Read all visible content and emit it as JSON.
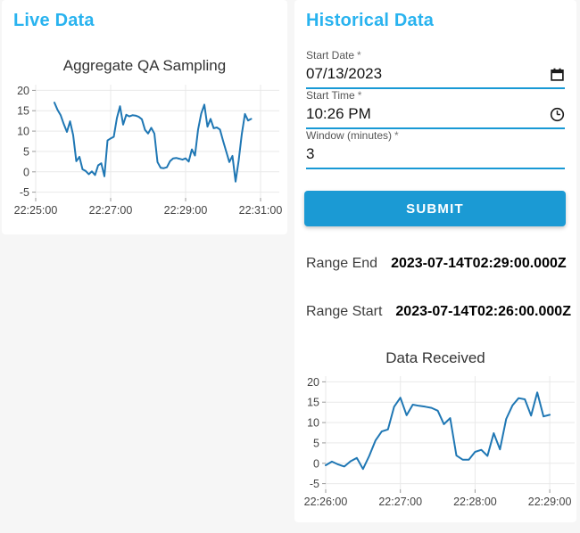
{
  "colors": {
    "heading_blue": "#29b3ef",
    "accent_blue": "#1899d5",
    "submit_blue": "#1b9ad4",
    "chart_line": "#1f77b4",
    "grid_gray": "#e9e9e9"
  },
  "live_panel": {
    "heading": "Live Data"
  },
  "historical_panel": {
    "heading": "Historical Data",
    "form": {
      "fields": [
        {
          "label": "Start Date",
          "required_marker": "*",
          "value": "07/13/2023",
          "icon": "calendar-icon"
        },
        {
          "label": "Start Time",
          "required_marker": "*",
          "value": "10:26 PM",
          "icon": "clock-icon"
        },
        {
          "label": "Window (minutes)",
          "required_marker": "*",
          "value": "3",
          "icon": ""
        }
      ],
      "submit_label": "SUBMIT"
    },
    "results": [
      {
        "label": "Range End",
        "value": "2023-07-14T02:29:00.000Z"
      },
      {
        "label": "Range Start",
        "value": "2023-07-14T02:26:00.000Z"
      }
    ]
  },
  "chart_data": [
    {
      "type": "line",
      "title": "Aggregate QA Sampling",
      "xlabel": "",
      "ylabel": "",
      "grid": true,
      "legend": false,
      "x_tick_labels": [
        "22:25:00",
        "22:27:00",
        "22:29:00",
        "22:31:00"
      ],
      "x_tick_seconds": [
        0,
        120,
        240,
        360
      ],
      "x_range_seconds": [
        0,
        390
      ],
      "x_axis_start_time": "22:25:00",
      "y_ticks": [
        -5,
        0,
        5,
        10,
        15,
        20
      ],
      "y_range": [
        -6.4,
        21.4
      ],
      "series_start_time": "22:25:30",
      "series_start_seconds": 30,
      "series_step_seconds": 5,
      "values": [
        17.0,
        15.2,
        13.9,
        11.7,
        9.8,
        12.4,
        9.0,
        2.6,
        3.7,
        0.6,
        0.2,
        -0.6,
        0.1,
        -0.8,
        1.6,
        2.1,
        -1.1,
        7.7,
        8.2,
        8.6,
        13.2,
        16.1,
        11.6,
        14.0,
        13.6,
        13.9,
        13.8,
        13.5,
        12.9,
        10.3,
        9.4,
        10.8,
        9.4,
        2.4,
        1.0,
        0.9,
        1.1,
        2.6,
        3.3,
        3.4,
        3.2,
        3.0,
        3.3,
        2.5,
        5.5,
        4.0,
        10.4,
        14.3,
        16.5,
        11.1,
        13.0,
        10.7,
        10.9,
        10.4,
        7.6,
        5.0,
        2.4,
        3.9,
        -2.4,
        2.8,
        9.3,
        14.2,
        12.6,
        13.0
      ]
    },
    {
      "type": "line",
      "title": "Data Received",
      "xlabel": "",
      "ylabel": "",
      "grid": true,
      "legend": false,
      "x_tick_labels": [
        "22:26:00",
        "22:27:00",
        "22:28:00",
        "22:29:00"
      ],
      "x_tick_seconds": [
        0,
        60,
        120,
        180
      ],
      "x_range_seconds": [
        0,
        200
      ],
      "x_axis_start_time": "22:26:00",
      "y_ticks": [
        -5,
        0,
        5,
        10,
        15,
        20
      ],
      "y_range": [
        -6.4,
        21.4
      ],
      "series_start_time": "22:26:00",
      "series_start_seconds": 0,
      "series_step_seconds": 5,
      "values": [
        -0.5,
        0.4,
        -0.3,
        -0.8,
        0.5,
        1.3,
        -1.4,
        1.8,
        5.6,
        7.8,
        8.3,
        13.9,
        16.1,
        11.8,
        14.4,
        14.1,
        13.9,
        13.6,
        12.9,
        9.6,
        11.1,
        1.9,
        0.9,
        0.9,
        2.8,
        3.3,
        1.8,
        7.4,
        3.4,
        10.9,
        14.2,
        16.0,
        15.7,
        11.7,
        17.4,
        11.5,
        11.9
      ]
    }
  ]
}
